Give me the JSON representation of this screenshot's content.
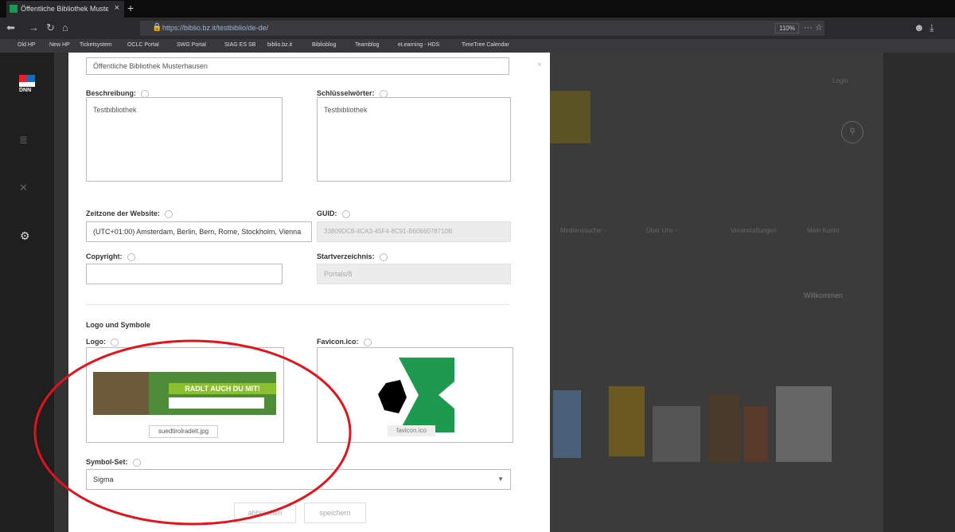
{
  "browser": {
    "tab_title": "Öffentliche Bibliothek Muster",
    "url": "https://biblio.bz.it/testbiblio/de-de/",
    "zoom": "110%",
    "bookmarks": [
      "Old HP",
      "New HP",
      "Ticketsystem",
      "OCLC Portal",
      "SWG Portal",
      "SIAG ES SB",
      "biblio.bz.it",
      "Biblioblog",
      "Teamblog",
      "eLearning - HDS",
      "TimeTree Calendar"
    ]
  },
  "modal": {
    "site_name": "Öffentliche Bibliothek Musterhausen",
    "description_label": "Beschreibung:",
    "description_value": "Testbibliothek",
    "keywords_label": "Schlüsselwörter:",
    "keywords_value": "Testbibliothek",
    "timezone_label": "Zeitzone der Website:",
    "timezone_value": "(UTC+01:00) Amsterdam, Berlin, Bern, Rome, Stockholm, Vienna",
    "guid_label": "GUID:",
    "guid_value": "33809DC8-4CA3-45F4-8C91-B6066078710B",
    "copyright_label": "Copyright:",
    "copyright_value": "",
    "homedir_label": "Startverzeichnis:",
    "homedir_value": "Portals/8",
    "logos_section_title": "Logo und Symbole",
    "logo_label": "Logo:",
    "logo_filename": "suedtirolradelt.jpg",
    "logo_banner_text": "RADLT AUCH DU MIT!",
    "favicon_label": "Favicon.ico:",
    "favicon_filename": "favicon.ico",
    "iconset_label": "Symbol-Set:",
    "iconset_value": "Sigma",
    "cancel_label": "abbrechen",
    "save_label": "speichern"
  },
  "background": {
    "nav_items": [
      "Medienssuche ~",
      "Über Uns ~",
      "Veranstaltungen",
      "Mein Konto"
    ],
    "welcome": "Willkommen",
    "login": "Login"
  },
  "colors": {
    "dnn_red": "#e3222e",
    "dnn_blue": "#0f6fb8",
    "favicon_green": "#1e9a4f",
    "annotation": "#e0141d"
  }
}
